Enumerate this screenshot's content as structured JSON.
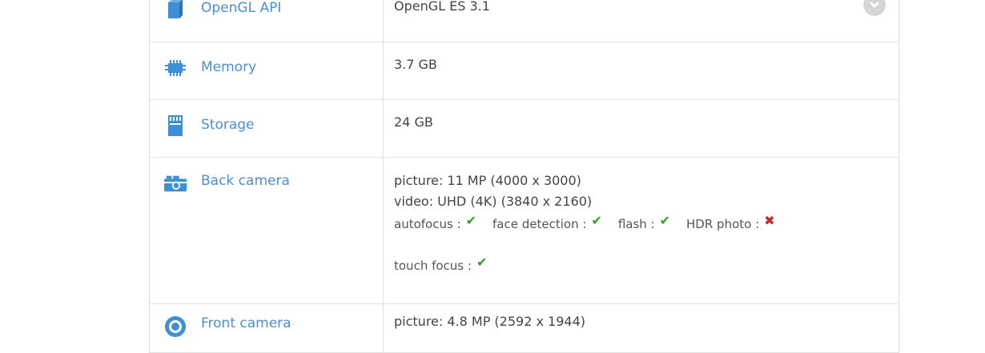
{
  "colors": {
    "label": "#4a8fd0",
    "value": "#444444",
    "icon": "#3d8fd6",
    "check": "#3a9a2a",
    "cross": "#c8232b",
    "border": "#e2e2e2"
  },
  "rows": [
    {
      "icon": "opengl-icon",
      "label": "OpenGL API",
      "value": "OpenGL ES 3.1"
    },
    {
      "icon": "memory-chip-icon",
      "label": "Memory",
      "value": "3.7 GB"
    },
    {
      "icon": "sd-card-icon",
      "label": "Storage",
      "value": "24 GB"
    },
    {
      "icon": "camera-icon",
      "label": "Back camera",
      "picture": "picture: 11 MP (4000 x 3000)",
      "video": "video: UHD (4K) (3840 x 2160)",
      "features": [
        {
          "name": "autofocus :",
          "supported": true,
          "mark": "✔"
        },
        {
          "name": "face detection :",
          "supported": true,
          "mark": "✔"
        },
        {
          "name": "flash :",
          "supported": true,
          "mark": "✔"
        },
        {
          "name": "HDR photo :",
          "supported": false,
          "mark": "✖"
        },
        {
          "name": "touch focus :",
          "supported": true,
          "mark": "✔"
        }
      ]
    },
    {
      "icon": "front-camera-icon",
      "label": "Front camera",
      "value": "picture: 4.8 MP (2592 x 1944)"
    }
  ]
}
